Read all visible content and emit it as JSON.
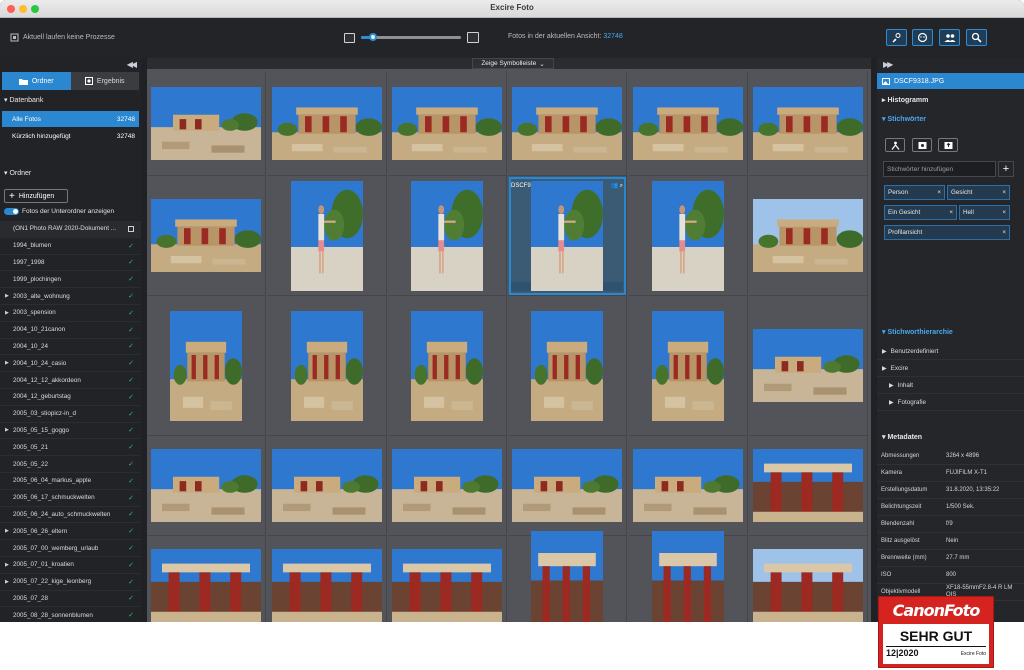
{
  "app": {
    "title": "Excire Foto"
  },
  "toolbar": {
    "process_status": "Aktuell laufen keine Prozesse",
    "count_label": "Fotos in der aktuellen Ansicht:",
    "count_value": "32748",
    "zoom_level": 0.12,
    "buttons": [
      {
        "icon": "person-search-icon"
      },
      {
        "icon": "face-icon"
      },
      {
        "icon": "people-icon"
      },
      {
        "icon": "magnifier-icon"
      }
    ]
  },
  "sidebar": {
    "tab_folders": "Ordner",
    "tab_results": "Ergebnis",
    "db_header": "Datenbank",
    "db_rows": [
      {
        "label": "Alle Fotos",
        "count": "32748"
      },
      {
        "label": "Kürzlich hinzugefügt",
        "count": "32748"
      }
    ],
    "folders_header": "Ordner",
    "add_button": "Hinzufügen",
    "subfolders_toggle": "Fotos der Unterordner anzeigen",
    "folders": [
      {
        "label": "(ON1 Photo RAW 2020-Dokument ...",
        "arrow": false,
        "mark": "box"
      },
      {
        "label": "1994_blumen",
        "arrow": false,
        "mark": "check"
      },
      {
        "label": "1997_1998",
        "arrow": false,
        "mark": "check"
      },
      {
        "label": "1999_plochingen",
        "arrow": false,
        "mark": "check"
      },
      {
        "label": "2003_alte_wohnung",
        "arrow": true,
        "mark": "check"
      },
      {
        "label": "2003_spension",
        "arrow": true,
        "mark": "check"
      },
      {
        "label": "2004_10_21canon",
        "arrow": false,
        "mark": "check"
      },
      {
        "label": "2004_10_24",
        "arrow": false,
        "mark": "check"
      },
      {
        "label": "2004_10_24_casio",
        "arrow": true,
        "mark": "check"
      },
      {
        "label": "2004_12_12_akkordeon",
        "arrow": false,
        "mark": "check"
      },
      {
        "label": "2004_12_geburtstag",
        "arrow": false,
        "mark": "check"
      },
      {
        "label": "2005_03_stiopicz-in_d",
        "arrow": false,
        "mark": "check"
      },
      {
        "label": "2005_05_15_goggo",
        "arrow": true,
        "mark": "check"
      },
      {
        "label": "2005_05_21",
        "arrow": false,
        "mark": "check"
      },
      {
        "label": "2005_05_22",
        "arrow": false,
        "mark": "check"
      },
      {
        "label": "2005_06_04_markus_apple",
        "arrow": false,
        "mark": "check"
      },
      {
        "label": "2005_06_17_schmuckwelten",
        "arrow": false,
        "mark": "check"
      },
      {
        "label": "2005_06_24_auto_schmuckwelten",
        "arrow": false,
        "mark": "check"
      },
      {
        "label": "2005_06_26_eltern",
        "arrow": true,
        "mark": "check"
      },
      {
        "label": "2005_07_00_wemberg_urlaub",
        "arrow": false,
        "mark": "check"
      },
      {
        "label": "2005_07_01_kroatien",
        "arrow": true,
        "mark": "check"
      },
      {
        "label": "2005_07_22_kige_leonberg",
        "arrow": true,
        "mark": "check"
      },
      {
        "label": "2005_07_28",
        "arrow": false,
        "mark": "check"
      },
      {
        "label": "2005_08_28_sonnenblumen",
        "arrow": false,
        "mark": "check"
      }
    ]
  },
  "grid": {
    "symbolbar_label": "Zeige Symbolleiste",
    "selected_label": "DSCF9318.JPG",
    "rows": [
      [
        "ruins-wide",
        "palace-blue",
        "palace-blue",
        "palace-front",
        "palace-front",
        "palace-front"
      ],
      [
        "palace-front",
        "man-portrait",
        "man-portrait",
        "man-selected",
        "man-portrait",
        "palace-pale"
      ],
      [
        "palace-column",
        "palace-tree",
        "palace-tree",
        "palace-tree",
        "palace-tree",
        "ruins-wide"
      ],
      [
        "ruins-low",
        "ruins-low",
        "ruins-low",
        "ruins-low",
        "ruins-low",
        "columns-close"
      ],
      [
        "columns-red",
        "columns-red",
        "columns-red",
        "columns-portrait",
        "columns-portrait",
        "columns-pale"
      ]
    ]
  },
  "right": {
    "file_name": "DSCF9318.JPG",
    "histogram": "Histogramm",
    "keywords_header": "Stichwörter",
    "keyword_placeholder": "Stichwörter hinzufügen",
    "keywords": [
      "Person",
      "Gesicht",
      "Ein Gesicht",
      "Hell",
      "Profilansicht"
    ],
    "hierarchy_header": "Stichworthierarchie",
    "hierarchy": [
      {
        "label": "Benutzerdefiniert",
        "indent": 0
      },
      {
        "label": "Excire",
        "indent": 0
      },
      {
        "label": "Inhalt",
        "indent": 1
      },
      {
        "label": "Fotografie",
        "indent": 1
      }
    ],
    "metadata_header": "Metadaten",
    "metadata": [
      {
        "k": "Abmessungen",
        "v": "3264 x 4896"
      },
      {
        "k": "Kamera",
        "v": "FUJIFILM X-T1"
      },
      {
        "k": "Erstellungsdatum",
        "v": "31.8.2020, 13:35:22"
      },
      {
        "k": "Belichtungszeit",
        "v": "1/500 Sek."
      },
      {
        "k": "Blendenzahl",
        "v": "f/9"
      },
      {
        "k": "Blitz ausgelöst",
        "v": "Nein"
      },
      {
        "k": "Brennweite (mm)",
        "v": "27.7 mm"
      },
      {
        "k": "ISO",
        "v": "800"
      },
      {
        "k": "Objektivmodell",
        "v": "XF18-55mmF2.8-4 R LM OIS"
      }
    ]
  },
  "badge": {
    "magazine": "CanonFoto",
    "rating": "SEHR GUT",
    "issue": "12|2020",
    "product": "Excire Foto"
  },
  "colors": {
    "accent": "#2b87cf",
    "check": "#3fb868",
    "badge": "#d5231f"
  }
}
